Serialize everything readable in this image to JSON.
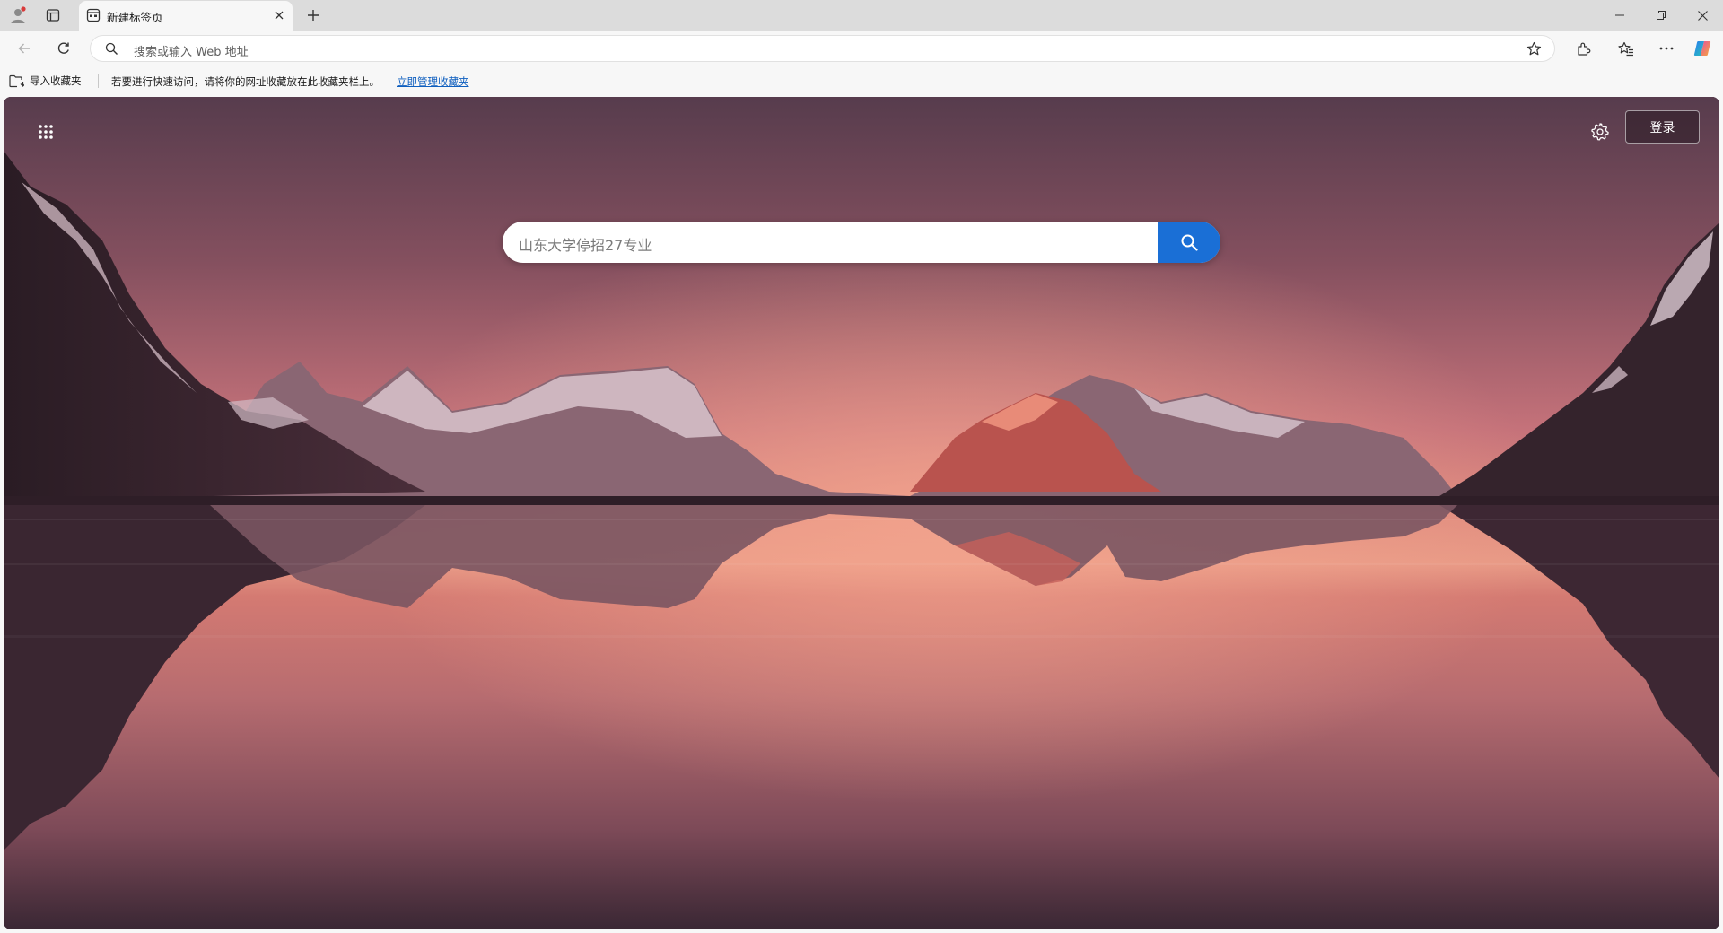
{
  "browser": {
    "tab": {
      "title": "新建标签页"
    },
    "address_bar": {
      "placeholder": "搜索或输入 Web 地址"
    },
    "favorites_bar": {
      "import_label": "导入收藏夹",
      "hint_text": "若要进行快速访问，请将你的网址收藏放在此收藏夹栏上。",
      "manage_link": "立即管理收藏夹"
    }
  },
  "new_tab_page": {
    "login_label": "登录",
    "search_query": "山东大学停招27专业"
  },
  "icons": [
    "profile-icon",
    "tab-actions-icon",
    "tab-favicon",
    "tab-close-icon",
    "new-tab-icon",
    "minimize-icon",
    "restore-icon",
    "window-close-icon",
    "back-icon",
    "refresh-icon",
    "search-icon",
    "favorite-star-icon",
    "extensions-icon",
    "favorites-icon",
    "more-icon",
    "copilot-icon",
    "folder-import-icon",
    "apps-grid-icon",
    "gear-icon"
  ],
  "colors": {
    "accent": "#1a6fd6",
    "link": "#0f5fbf",
    "chrome": "#f7f7f7",
    "tab_strip": "#dcdcdc"
  }
}
